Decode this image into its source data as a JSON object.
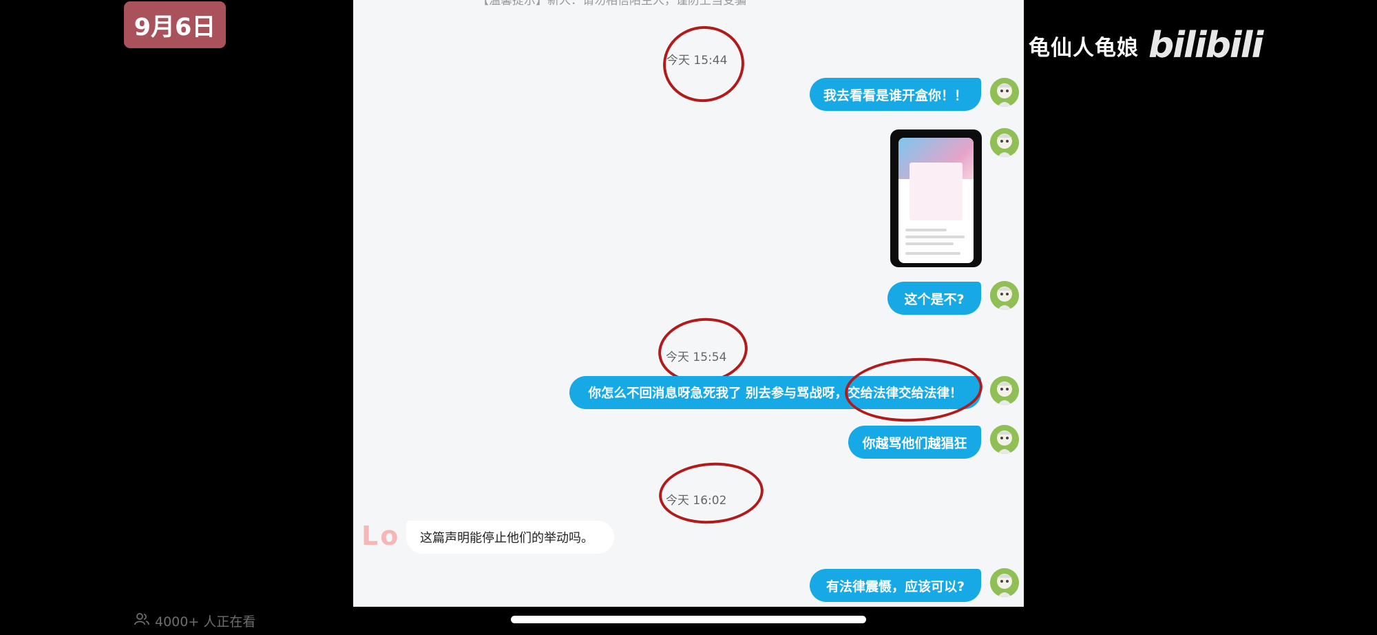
{
  "overlay": {
    "date_badge": "9月6日",
    "watermark_name": "龟仙人龟娘",
    "watermark_logo": "bilibili",
    "viewer_count": "4000+ 人正在看"
  },
  "chat": {
    "top_notice": "【温馨提示】新人：请勿相信陌生人，谨防上当受骗",
    "messages": [
      {
        "type": "timestamp",
        "text": "今天 15:44"
      },
      {
        "type": "outgoing",
        "text": "我去看看是谁开盒你！！"
      },
      {
        "type": "outgoing-image",
        "text": ""
      },
      {
        "type": "outgoing",
        "text": "这个是不?"
      },
      {
        "type": "timestamp",
        "text": "今天 15:54"
      },
      {
        "type": "outgoing",
        "text": "你怎么不回消息呀急死我了 别去参与骂战呀，交给法律交给法律！"
      },
      {
        "type": "outgoing",
        "text": "你越骂他们越猖狂"
      },
      {
        "type": "timestamp",
        "text": "今天 16:02"
      },
      {
        "type": "incoming",
        "text": "这篇声明能停止他们的举动吗。",
        "avatar_text": "Lo"
      },
      {
        "type": "outgoing",
        "text": "有法律震慑，应该可以?"
      }
    ]
  },
  "colors": {
    "outgoing_bubble": "#16a9e6",
    "incoming_bubble": "#ffffff",
    "annotation_circle": "#b21b1b",
    "date_badge": "#a9525b",
    "chat_bg": "#f5f6f8"
  },
  "icons": {
    "viewer": "people-icon",
    "avatar": "user-avatar-icon"
  }
}
